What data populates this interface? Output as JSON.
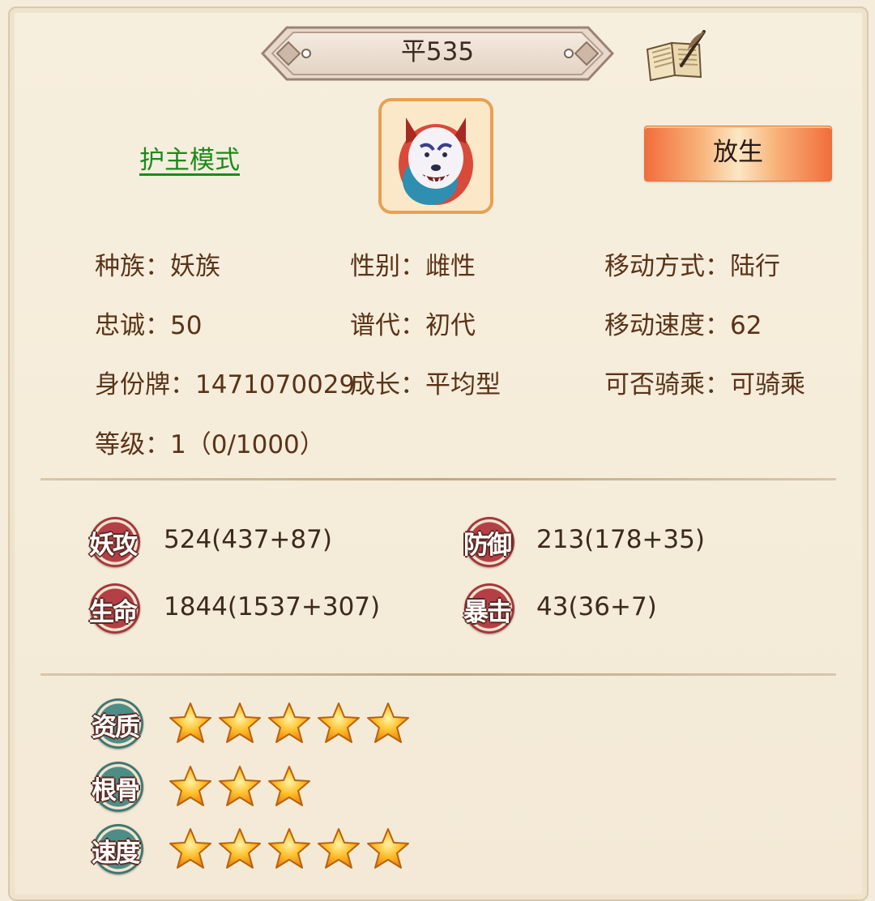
{
  "title": "平535",
  "guard_mode": "护主模式",
  "release_button": "放生",
  "info": [
    {
      "label": "种族：",
      "value": "妖族"
    },
    {
      "label": "性别：",
      "value": "雌性"
    },
    {
      "label": "移动方式：",
      "value": "陆行"
    },
    {
      "label": "忠诚：",
      "value": "50"
    },
    {
      "label": "谱代：",
      "value": "初代"
    },
    {
      "label": "移动速度：",
      "value": "62"
    },
    {
      "label": "身份牌：",
      "value": "1471070029"
    },
    {
      "label": "成长：",
      "value": "平均型"
    },
    {
      "label": "可否骑乘：",
      "value": "可骑乘"
    },
    {
      "label": "等级：",
      "value": "1（0/1000）"
    }
  ],
  "stats": [
    {
      "name": "妖攻",
      "value": "524(437+87)"
    },
    {
      "name": "防御",
      "value": "213(178+35)"
    },
    {
      "name": "生命",
      "value": "1844(1537+307)"
    },
    {
      "name": "暴击",
      "value": "43(36+7)"
    }
  ],
  "aptitudes": [
    {
      "name": "资质",
      "stars": 5
    },
    {
      "name": "根骨",
      "stars": 3
    },
    {
      "name": "速度",
      "stars": 5
    }
  ],
  "colors": {
    "background": "#f5ecdb",
    "label_text": "#5a3318",
    "guard_link": "#1c8a1c",
    "stat_badge": "#b53f46",
    "aptitude_badge": "#4e8c86",
    "star": "#f7a51c"
  },
  "icons": [
    "book-quill-icon",
    "pet-wolf-avatar",
    "star-icon"
  ]
}
